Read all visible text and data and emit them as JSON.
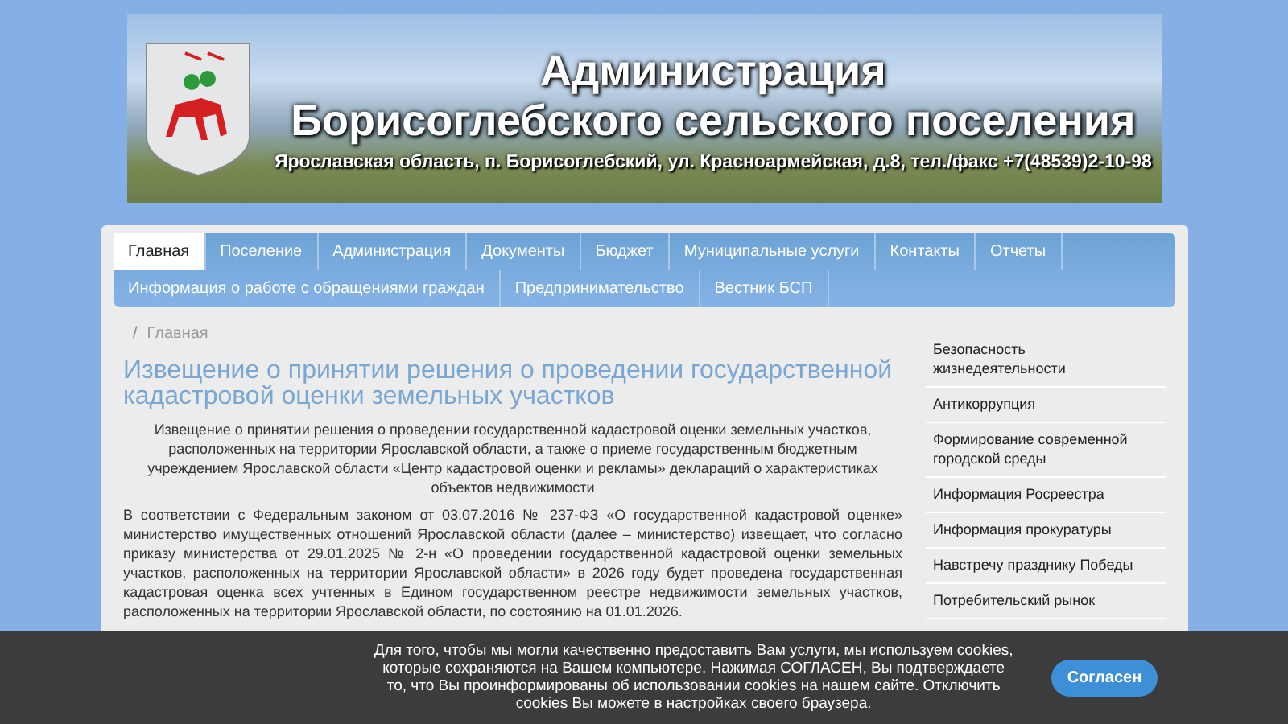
{
  "header": {
    "title": "Администрация",
    "subtitle": "Борисоглебского сельского поселения",
    "address": "Ярославская область, п. Борисоглебский, ул. Красноармейская, д.8, тел./факс +7(48539)2-10-98"
  },
  "nav": {
    "tabs": [
      {
        "label": "Главная",
        "selected": true
      },
      {
        "label": "Поселение",
        "selected": false
      },
      {
        "label": "Администрация",
        "selected": false
      },
      {
        "label": "Документы",
        "selected": false
      },
      {
        "label": "Бюджет",
        "selected": false
      },
      {
        "label": "Муниципальные услуги",
        "selected": false
      },
      {
        "label": "Контакты",
        "selected": false
      },
      {
        "label": "Отчеты",
        "selected": false
      },
      {
        "label": "Информация о работе с обращениями граждан",
        "selected": false
      },
      {
        "label": "Предпринимательство",
        "selected": false
      },
      {
        "label": "Вестник БСП",
        "selected": false
      }
    ]
  },
  "breadcrumb": {
    "separator": "/",
    "items": [
      "Главная"
    ]
  },
  "article": {
    "title": "Извещение о принятии решения о проведении государственной кадастровой оценки земельных участков",
    "lead": "Извещение о принятии решения о проведении государственной кадастровой оценки земельных участков, расположенных на территории Ярославской области, а также о приеме государственным бюджетным учреждением Ярославской области «Центр кадастровой оценки и рекламы» деклараций о характеристиках объектов недвижимости",
    "body": "В соответствии с Федеральным законом от 03.07.2016 №  237-ФЗ «О государственной кадастровой оценке» министерство имущественных отношений Ярославской области (далее – министерство) извещает, что согласно приказу министерства от 29.01.2025 №  2-н «О проведении государственной кадастровой оценки земельных участков, расположенных на территории Ярославской области» в 2026 году будет проведена государственная кадастровая оценка всех учтенных в Едином государственном реестре недвижимости земельных участков, расположенных на территории Ярославской области, по состоянию на 01.01.2026."
  },
  "sidebar": {
    "items": [
      "Безопасность жизнедеятельности",
      "Антикоррупция",
      "Формирование современной городской среды",
      "Информация Росреестра",
      "Информация прокуратуры",
      "Навстречу празднику Победы",
      "Потребительский рынок"
    ]
  },
  "cookie_notice": {
    "text": "Для того, чтобы мы могли качественно предоставить Вам услуги, мы используем cookies, которые сохраняются на Вашем компьютере. Нажимая СОГЛАСЕН, Вы подтверждаете то, что Вы проинформированы об использовании cookies на нашем сайте. Отключить cookies Вы можете в настройках своего браузера.",
    "button": "Согласен"
  }
}
